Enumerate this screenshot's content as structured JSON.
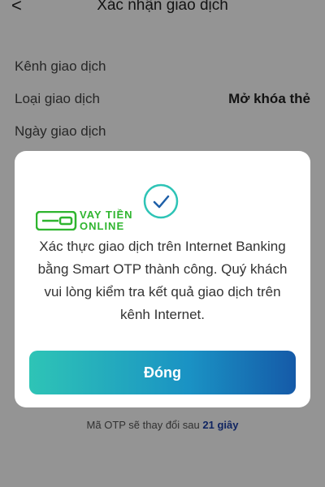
{
  "header": {
    "back_icon": "chevron-left-icon",
    "back_glyph": "<",
    "title": "Xác nhận giao dịch"
  },
  "details": {
    "channel_label": "Kênh giao dịch",
    "type_label": "Loại giao dịch",
    "type_value": "Mở khóa thẻ",
    "date_label": "Ngày giao dịch"
  },
  "otp": {
    "note_prefix": "Mã OTP sẽ thay đổi sau",
    "countdown": "21 giây"
  },
  "dialog": {
    "icon": "check-circle-icon",
    "accent_color": "#2ec4b6",
    "message": "Xác thực giao dịch trên Internet Banking bằng Smart OTP thành công. Quý khách vui lòng kiểm tra kết quả giao dịch trên kênh Internet.",
    "close_label": "Đóng"
  },
  "watermark": {
    "line1": "VAY TIỀN",
    "line2": "ONLINE"
  }
}
